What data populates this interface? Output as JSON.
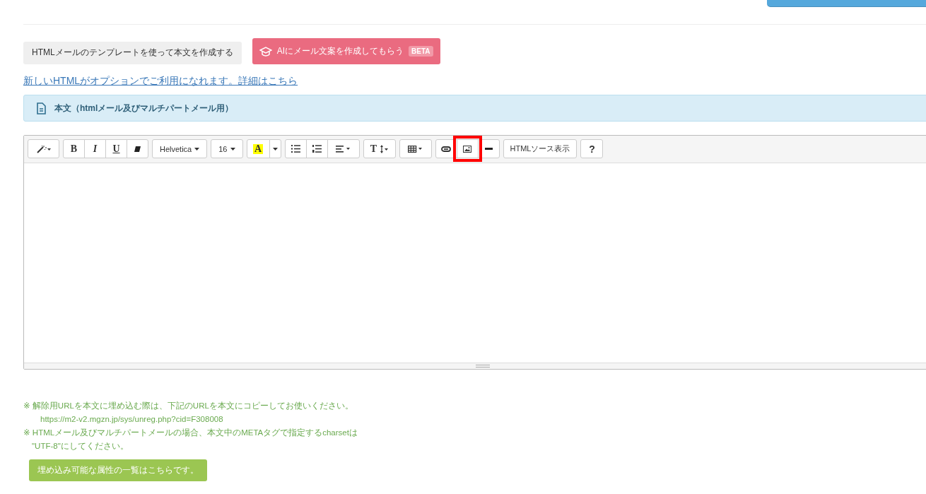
{
  "template_button": {
    "label": "HTMLメールのテンプレートを使って本文を作成する"
  },
  "ai_button": {
    "label": "AIにメール文案を作成してもらう",
    "badge": "BETA"
  },
  "option_link": "新しいHTMLがオプションでご利用になれます。詳細はこちら",
  "section_header": {
    "title": "本文（htmlメール及びマルチパートメール用）"
  },
  "toolbar": [
    [
      {
        "kind": "wand",
        "highlighted": false
      }
    ],
    [
      {
        "kind": "bold",
        "label": "B",
        "highlighted": false
      },
      {
        "kind": "italic",
        "label": "I",
        "highlighted": false
      },
      {
        "kind": "underline",
        "label": "U",
        "highlighted": false
      },
      {
        "kind": "eraser",
        "highlighted": false
      }
    ],
    [
      {
        "kind": "dropdown",
        "label": "Helvetica",
        "highlighted": false
      }
    ],
    [
      {
        "kind": "dropdown",
        "label": "16",
        "highlighted": false
      }
    ],
    [
      {
        "kind": "color",
        "label": "A",
        "highlighted": false
      },
      {
        "kind": "caret",
        "highlighted": false
      }
    ],
    [
      {
        "kind": "ul",
        "highlighted": false
      },
      {
        "kind": "ol",
        "highlighted": false
      },
      {
        "kind": "align",
        "highlighted": false
      }
    ],
    [
      {
        "kind": "height",
        "label": "T",
        "highlighted": false
      }
    ],
    [
      {
        "kind": "table",
        "highlighted": false
      }
    ],
    [
      {
        "kind": "link",
        "highlighted": false
      },
      {
        "kind": "image",
        "highlighted": true
      },
      {
        "kind": "hr",
        "highlighted": false
      }
    ],
    [
      {
        "kind": "text",
        "label": "HTMLソース表示",
        "highlighted": false
      }
    ],
    [
      {
        "kind": "help",
        "label": "?",
        "highlighted": false
      }
    ]
  ],
  "notes": [
    {
      "kind": "note",
      "text": "※ 解除用URLを本文に埋め込む際は、下記のURLを本文にコピーしてお使いください。"
    },
    {
      "kind": "url",
      "text": "https://m2-v2.mgzn.jp/sys/unreg.php?cid=F308008"
    },
    {
      "kind": "note",
      "text": "※ HTMLメール及びマルチパートメールの場合、本文中のMETAタグで指定するcharsetは"
    },
    {
      "kind": "cont",
      "text": "\"UTF-8\"にしてください。"
    }
  ],
  "attributes_button": {
    "label": "埋め込み可能な属性の一覧はこちらです。"
  }
}
